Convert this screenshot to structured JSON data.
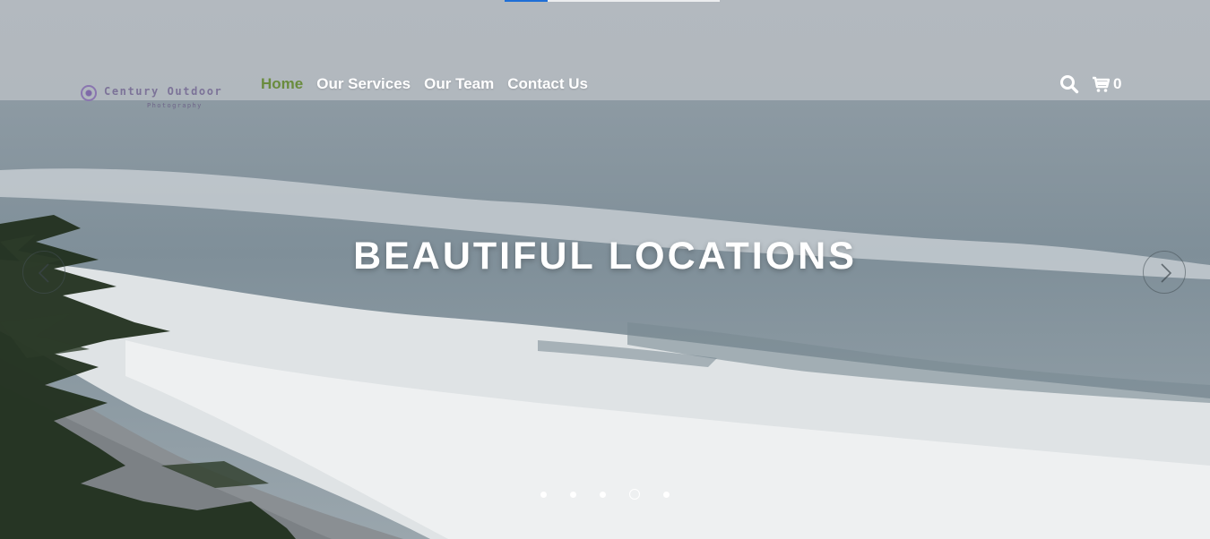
{
  "slider": {
    "progress": 0.2,
    "title": "BEAUTIFUL LOCATIONS",
    "slide_count": 5,
    "active_index": 3
  },
  "logo": {
    "name": "Century Outdoor",
    "sub": "Photography"
  },
  "nav": {
    "items": [
      {
        "label": "Home",
        "active": true
      },
      {
        "label": "Our Services",
        "active": false
      },
      {
        "label": "Our Team",
        "active": false
      },
      {
        "label": "Contact Us",
        "active": false
      }
    ]
  },
  "header": {
    "search_icon": "search-icon",
    "cart_icon": "cart-icon",
    "cart_count": "0"
  },
  "colors": {
    "nav_active": "#6a8c3e",
    "nav_text": "#ffffff",
    "progress": "#1f6fd6"
  },
  "icons": {
    "prev": "chevron-left-icon",
    "next": "chevron-right-icon"
  }
}
